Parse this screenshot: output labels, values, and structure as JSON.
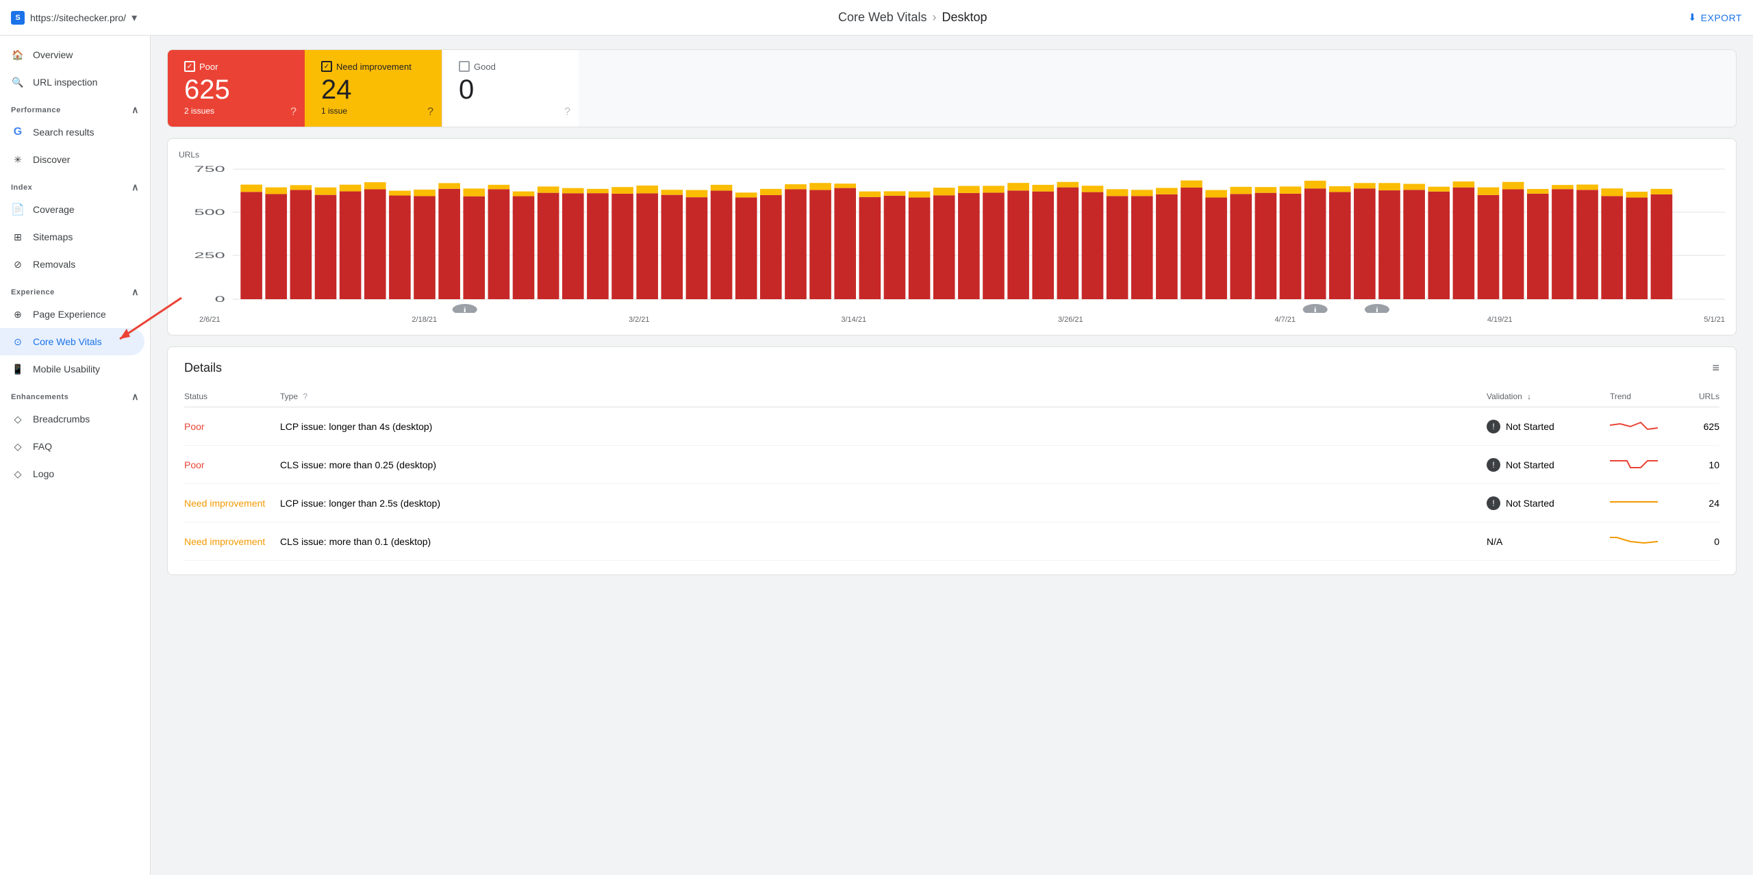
{
  "topbar": {
    "site_url": "https://sitechecker.pro/",
    "breadcrumb_parent": "Core Web Vitals",
    "breadcrumb_separator": "›",
    "breadcrumb_current": "Desktop",
    "export_label": "EXPORT"
  },
  "sidebar": {
    "overview_label": "Overview",
    "url_inspection_label": "URL inspection",
    "sections": [
      {
        "name": "Performance",
        "items": [
          {
            "label": "Search results",
            "icon": "google"
          },
          {
            "label": "Discover",
            "icon": "asterisk"
          }
        ]
      },
      {
        "name": "Index",
        "items": [
          {
            "label": "Coverage",
            "icon": "file"
          },
          {
            "label": "Sitemaps",
            "icon": "sitemap"
          },
          {
            "label": "Removals",
            "icon": "removals"
          }
        ]
      },
      {
        "name": "Experience",
        "items": [
          {
            "label": "Page Experience",
            "icon": "experience"
          },
          {
            "label": "Core Web Vitals",
            "icon": "cwv",
            "active": true
          },
          {
            "label": "Mobile Usability",
            "icon": "mobile"
          }
        ]
      },
      {
        "name": "Enhancements",
        "items": [
          {
            "label": "Breadcrumbs",
            "icon": "breadcrumbs"
          },
          {
            "label": "FAQ",
            "icon": "faq"
          },
          {
            "label": "Logo",
            "icon": "logo"
          }
        ]
      }
    ]
  },
  "status_cards": {
    "poor": {
      "label": "Poor",
      "count": "625",
      "issues": "2 issues"
    },
    "need_improvement": {
      "label": "Need improvement",
      "count": "24",
      "issues": "1 issue"
    },
    "good": {
      "label": "Good",
      "count": "0",
      "issues": ""
    }
  },
  "chart": {
    "y_label": "URLs",
    "y_ticks": [
      "750",
      "500",
      "250",
      "0"
    ],
    "x_labels": [
      "2/6/21",
      "2/18/21",
      "3/2/21",
      "3/14/21",
      "3/26/21",
      "4/7/21",
      "4/19/21",
      "5/1/21"
    ]
  },
  "details": {
    "title": "Details",
    "columns": {
      "status": "Status",
      "type": "Type",
      "validation": "Validation",
      "trend": "Trend",
      "urls": "URLs"
    },
    "rows": [
      {
        "status": "Poor",
        "status_class": "poor",
        "type": "LCP issue: longer than 4s (desktop)",
        "validation": "Not Started",
        "urls": "625"
      },
      {
        "status": "Poor",
        "status_class": "poor",
        "type": "CLS issue: more than 0.25 (desktop)",
        "validation": "Not Started",
        "urls": "10"
      },
      {
        "status": "Need improvement",
        "status_class": "need",
        "type": "LCP issue: longer than 2.5s (desktop)",
        "validation": "Not Started",
        "urls": "24"
      },
      {
        "status": "Need improvement",
        "status_class": "need",
        "type": "CLS issue: more than 0.1 (desktop)",
        "validation": "N/A",
        "urls": "0"
      }
    ]
  }
}
